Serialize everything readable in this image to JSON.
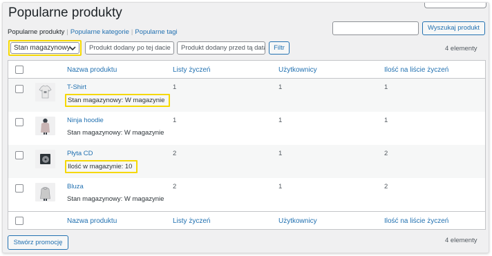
{
  "page": {
    "title": "Popularne produkty"
  },
  "subnav": {
    "current": "Popularne produkty",
    "sep": "|",
    "link_categories": "Popularne kategorie",
    "link_tags": "Popularne tagi"
  },
  "search": {
    "button_label": "Wyszukaj produkt",
    "value": ""
  },
  "filters": {
    "stock_select_value": "Stan magazynowy",
    "date_from_placeholder": "Produkt dodany po tej dacie",
    "date_to_placeholder": "Produkt dodany przed tą datą",
    "filter_button": "Filtr",
    "items_count": "4 elementy"
  },
  "table": {
    "columns": {
      "name": "Nazwa produktu",
      "wishlists": "Listy życzeń",
      "users": "Użytkownicy",
      "qty_on_wishlist": "Ilość na liście życzeń"
    },
    "rows": [
      {
        "name": "T-Shirt",
        "meta": "Stan magazynowy: W magazynie",
        "meta_highlighted": true,
        "wishlists": "1",
        "users": "1",
        "qty": "1",
        "thumb_icon": "tshirt-icon"
      },
      {
        "name": "Ninja hoodie",
        "meta": "Stan magazynowy: W magazynie",
        "meta_highlighted": false,
        "wishlists": "1",
        "users": "1",
        "qty": "1",
        "thumb_icon": "hoodie-icon"
      },
      {
        "name": "Płyta CD",
        "meta": "Ilość w magazynie: 10",
        "meta_highlighted": true,
        "wishlists": "2",
        "users": "1",
        "qty": "2",
        "thumb_icon": "cd-icon"
      },
      {
        "name": "Bluza",
        "meta": "Stan magazynowy: W magazynie",
        "meta_highlighted": false,
        "wishlists": "2",
        "users": "1",
        "qty": "2",
        "thumb_icon": "hoodie-icon"
      }
    ]
  },
  "footer": {
    "promo_button": "Stwórz promocję",
    "items_count": "4 elementy"
  },
  "colors": {
    "link": "#2271b1",
    "highlight": "#f5d800",
    "border": "#c3c4c7",
    "background": "#f0f0f1"
  }
}
